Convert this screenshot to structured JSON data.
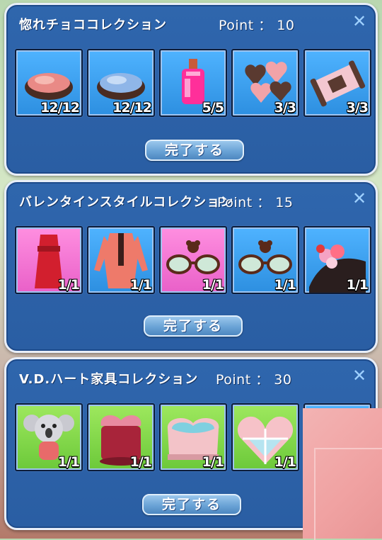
{
  "panels": [
    {
      "title": "惚れチョココレクション",
      "point_label": "Point",
      "point_sep": "：",
      "point_value": "10",
      "button_label": "完了する",
      "items": [
        {
          "name": "pink-powder-bowl",
          "count": "12/12"
        },
        {
          "name": "blue-powder-bowl",
          "count": "12/12"
        },
        {
          "name": "pink-potion-bottle",
          "count": "5/5"
        },
        {
          "name": "heart-chocolates",
          "count": "3/3"
        },
        {
          "name": "chocolate-scroll",
          "count": "3/3"
        }
      ]
    },
    {
      "title": "バレンタインスタイルコレクション",
      "point_label": "Point",
      "point_sep": "：",
      "point_value": "15",
      "button_label": "完了する",
      "items": [
        {
          "name": "red-dress",
          "count": "1/1"
        },
        {
          "name": "pink-suit",
          "count": "1/1"
        },
        {
          "name": "bear-glasses-pink",
          "count": "1/1"
        },
        {
          "name": "bear-glasses-blue",
          "count": "1/1"
        },
        {
          "name": "rose-hat",
          "count": "1/1"
        }
      ]
    },
    {
      "title": "V.D.ハート家具コレクション",
      "point_label": "Point",
      "point_sep": "：",
      "point_value": "30",
      "button_label": "完了する",
      "items": [
        {
          "name": "koala-plush",
          "count": "1/1"
        },
        {
          "name": "heart-box-red",
          "count": "1/1"
        },
        {
          "name": "heart-tub",
          "count": "1/1"
        },
        {
          "name": "heart-window",
          "count": "1/1"
        }
      ]
    }
  ],
  "colors": {
    "panel_bg": "#2f66ad",
    "slot_blue": "#3aa2f0",
    "slot_pink": "#f07ad8",
    "slot_green": "#7fd84a",
    "button": "#6aa3d6"
  }
}
